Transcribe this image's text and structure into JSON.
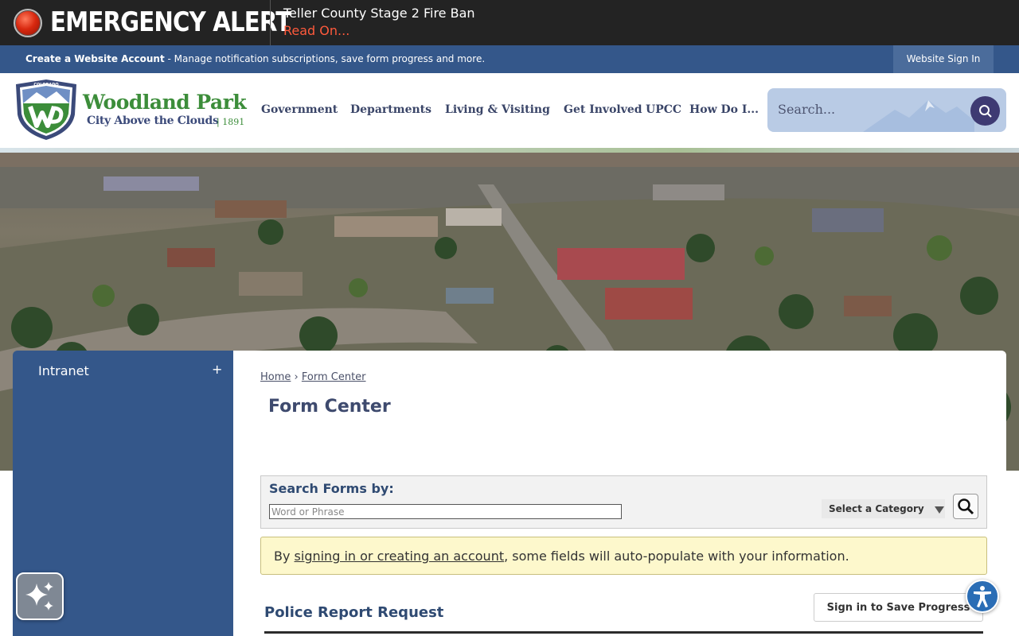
{
  "alert": {
    "title": "EMERGENCY ALERT",
    "message": "Teller County Stage 2 Fire Ban",
    "link": "Read On..."
  },
  "account_bar": {
    "create_account": "Create a Website Account",
    "description": " - Manage notification subscriptions, save form progress and more.",
    "sign_in": "Website Sign In"
  },
  "logo": {
    "badge_text": "COLORADO",
    "name": "Woodland Park",
    "tagline": "City Above the Clouds",
    "year": "| 1891"
  },
  "nav": {
    "items": [
      "Government",
      "Departments",
      "Living & Visiting",
      "Get Involved",
      "UPCC",
      "How Do I..."
    ]
  },
  "search": {
    "placeholder": "Search..."
  },
  "sidebar": {
    "items": [
      {
        "label": "Intranet",
        "toggle": "+"
      }
    ]
  },
  "breadcrumb": {
    "home": "Home",
    "separator": "›",
    "current": "Form Center"
  },
  "page": {
    "title": "Form Center"
  },
  "form_search": {
    "label": "Search Forms by:",
    "placeholder": "Word or Phrase",
    "category": "Select a Category"
  },
  "notice": {
    "before": "By ",
    "link": "signing in or creating an account",
    "after": ", some fields will auto-populate with your information."
  },
  "form": {
    "title": "Police Report Request",
    "save_button": "Sign in to Save Progress"
  },
  "colors": {
    "alert_bg": "#232323",
    "account_bar": "#34578a",
    "alert_link": "#ff5a3c",
    "notice_bg": "#fdf8cc",
    "brand_green": "#3c8d3a"
  }
}
